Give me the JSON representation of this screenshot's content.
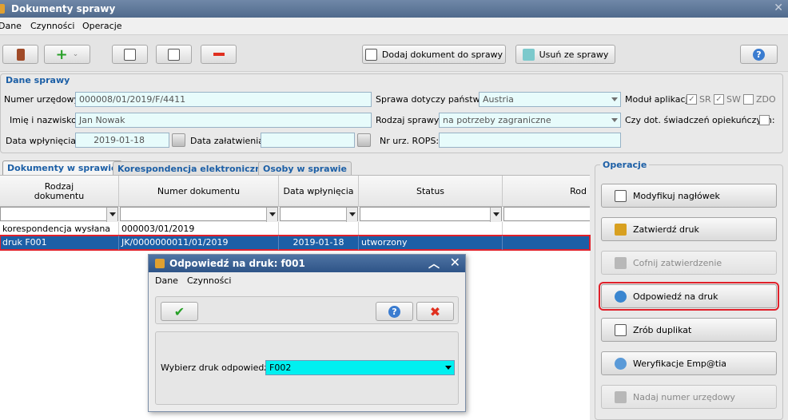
{
  "window": {
    "title": "Dokumenty sprawy"
  },
  "menu": [
    "Dane",
    "Czynności",
    "Operacje"
  ],
  "toolbar": {
    "add_document_label": "Dodaj dokument do sprawy",
    "remove_label": "Usuń ze sprawy"
  },
  "case": {
    "group_title": "Dane sprawy",
    "official_number_label": "Numer urzędowy:",
    "official_number": "000008/01/2019/F/4411",
    "country_label": "Sprawa dotyczy państwa:",
    "country": "Austria",
    "modules_label": "Moduł aplikacji:",
    "module_sr": "SR",
    "module_sw": "SW",
    "module_zdo": "ZDO",
    "name_label": "Imię i nazwisko:",
    "name": "Jan Nowak",
    "case_type_label": "Rodzaj sprawy:",
    "case_type": "na potrzeby zagraniczne",
    "care_benefit_label": "Czy dot. świadczeń opiekuńczych:",
    "received_date_label": "Data wpłynięcia:",
    "received_date": "2019-01-18",
    "closed_date_label": "Data załatwienia:",
    "closed_date": "",
    "rops_label": "Nr urz. ROPS:",
    "rops": ""
  },
  "tabs": [
    "Dokumenty w sprawie",
    "Korespondencja elektroniczna",
    "Osoby w sprawie"
  ],
  "grid": {
    "columns": [
      "Rodzaj dokumentu",
      "Numer dokumentu",
      "Data wpłynięcia",
      "Status",
      "Rod"
    ],
    "rows": [
      {
        "type": "korespondencja wysłana",
        "number": "000003/01/2019",
        "date": "",
        "status": ""
      },
      {
        "type": "druk F001",
        "number": "JK/0000000011/01/2019",
        "date": "2019-01-18",
        "status": "utworzony"
      }
    ]
  },
  "operations": {
    "title": "Operacje",
    "items": [
      {
        "label": "Modyfikuj nagłówek",
        "enabled": true
      },
      {
        "label": "Zatwierdź druk",
        "enabled": true
      },
      {
        "label": "Cofnij zatwierdzenie",
        "enabled": false
      },
      {
        "label": "Odpowiedź na druk",
        "enabled": true
      },
      {
        "label": "Zrób duplikat",
        "enabled": true
      },
      {
        "label": "Weryfikacje Emp@tia",
        "enabled": true
      },
      {
        "label": "Nadaj numer urzędowy",
        "enabled": false
      }
    ]
  },
  "dialog": {
    "title": "Odpowiedź na druk: f001",
    "menu": [
      "Dane",
      "Czynności"
    ],
    "select_label": "Wybierz druk odpowiedzi:",
    "select_value": "F002"
  },
  "colors": {
    "accent": "#1c5fa6",
    "highlight": "#e0202a",
    "field": "#e7fbfb",
    "dialog_select": "#00f0f0"
  }
}
